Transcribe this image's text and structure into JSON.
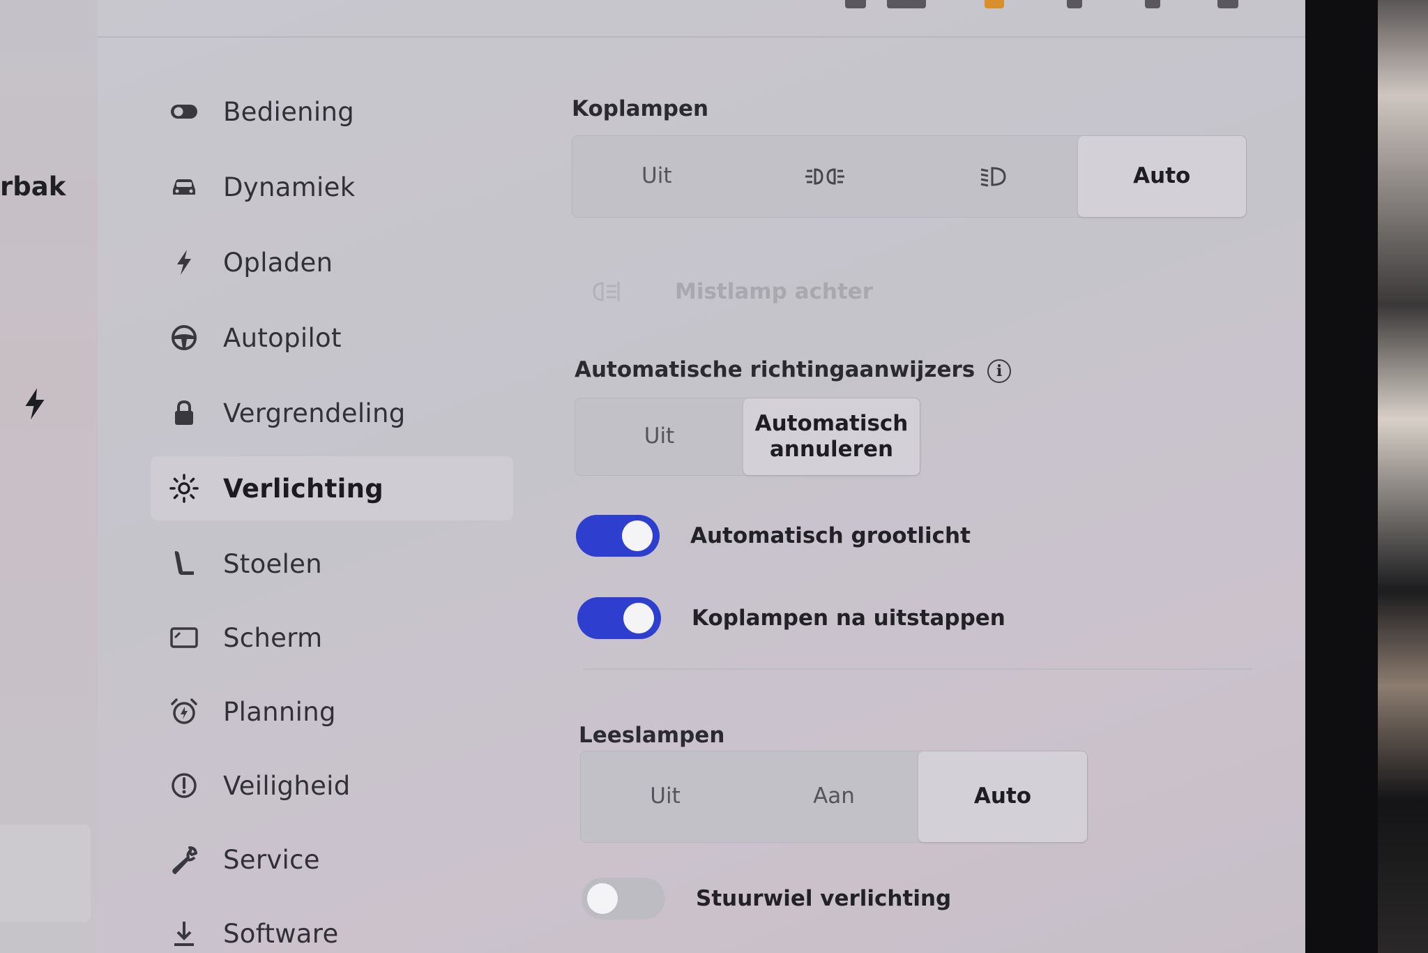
{
  "left_panel": {
    "label": "rbak"
  },
  "sidebar": {
    "items": [
      {
        "label": "Bediening",
        "icon": "toggle-icon"
      },
      {
        "label": "Dynamiek",
        "icon": "car-icon"
      },
      {
        "label": "Opladen",
        "icon": "bolt-icon"
      },
      {
        "label": "Autopilot",
        "icon": "steering-wheel-icon"
      },
      {
        "label": "Vergrendeling",
        "icon": "lock-icon"
      },
      {
        "label": "Verlichting",
        "icon": "sun-icon",
        "active": true
      },
      {
        "label": "Stoelen",
        "icon": "seat-icon"
      },
      {
        "label": "Scherm",
        "icon": "display-icon"
      },
      {
        "label": "Planning",
        "icon": "alarm-clock-icon"
      },
      {
        "label": "Veiligheid",
        "icon": "alert-circle-icon"
      },
      {
        "label": "Service",
        "icon": "wrench-icon"
      },
      {
        "label": "Software",
        "icon": "download-icon"
      }
    ]
  },
  "headlights": {
    "title": "Koplampen",
    "options": [
      "Uit",
      "parking-lights-icon",
      "low-beam-icon",
      "Auto"
    ],
    "selected": "Auto",
    "fog_rear_label": "Mistlamp achter"
  },
  "auto_indicators": {
    "title": "Automatische richtingaanwijzers",
    "options": [
      "Uit",
      "Automatisch annuleren"
    ],
    "selected": "Automatisch annuleren"
  },
  "toggles": {
    "auto_high_beam": {
      "label": "Automatisch grootlicht",
      "on": true
    },
    "headlights_after_exit": {
      "label": "Koplampen na uitstappen",
      "on": true
    },
    "steering_wheel_light": {
      "label": "Stuurwiel verlichting",
      "on": false
    }
  },
  "reading_lights": {
    "title": "Leeslampen",
    "options": [
      "Uit",
      "Aan",
      "Auto"
    ],
    "selected": "Auto"
  },
  "colors": {
    "accent": "#2e3fcf",
    "background": "#c7c5cc"
  }
}
